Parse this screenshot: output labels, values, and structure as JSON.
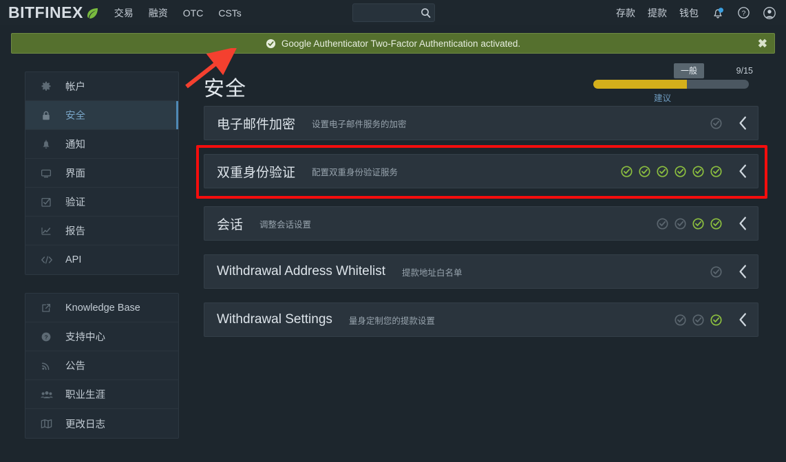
{
  "header": {
    "brand": "BITFINEX",
    "brand_icon": "leaf-icon",
    "nav_left": [
      {
        "label": "交易",
        "name": "nav-trading"
      },
      {
        "label": "融资",
        "name": "nav-funding"
      },
      {
        "label": "OTC",
        "name": "nav-otc"
      },
      {
        "label": "CSTs",
        "name": "nav-csts"
      }
    ],
    "search": {
      "value": "",
      "placeholder": "",
      "icon": "search-icon"
    },
    "nav_right": [
      {
        "label": "存款",
        "name": "nav-deposit"
      },
      {
        "label": "提款",
        "name": "nav-withdraw"
      },
      {
        "label": "钱包",
        "name": "nav-wallet"
      }
    ],
    "icons": [
      {
        "name": "bell-icon",
        "badge_color": "#3a9fe0"
      },
      {
        "name": "help-icon"
      },
      {
        "name": "user-avatar-icon"
      }
    ]
  },
  "alert": {
    "icon": "check-circle-icon",
    "message": "Google Authenticator Two-Factor Authentication activated.",
    "close_label": "✖",
    "bg_color": "#55702e"
  },
  "sidebar": {
    "groups": [
      {
        "items": [
          {
            "label": "帐户",
            "icon": "gear-icon",
            "active": false
          },
          {
            "label": "安全",
            "icon": "lock-icon",
            "active": true
          },
          {
            "label": "通知",
            "icon": "bell-icon",
            "active": false
          },
          {
            "label": "界面",
            "icon": "monitor-icon",
            "active": false
          },
          {
            "label": "验证",
            "icon": "checkbox-icon",
            "active": false
          },
          {
            "label": "报告",
            "icon": "chart-line-icon",
            "active": false
          },
          {
            "label": "API",
            "icon": "code-icon",
            "active": false
          }
        ]
      },
      {
        "items": [
          {
            "label": "Knowledge Base",
            "icon": "external-link-icon",
            "active": false
          },
          {
            "label": "支持中心",
            "icon": "question-circle-icon",
            "active": false
          },
          {
            "label": "公告",
            "icon": "rss-icon",
            "active": false
          },
          {
            "label": "职业生涯",
            "icon": "users-icon",
            "active": false
          },
          {
            "label": "更改日志",
            "icon": "book-icon",
            "active": false
          }
        ]
      }
    ]
  },
  "main": {
    "title": "安全",
    "meter": {
      "bubble_label": "一般",
      "count_label": "9/15",
      "caption": "建议",
      "percent": 60,
      "fill_color": "#d4af1b",
      "track_color": "#4b5761"
    },
    "cards": [
      {
        "title": "电子邮件加密",
        "subtitle": "设置电子邮件服务的加密",
        "checks": [
          "gray"
        ],
        "highlight": false
      },
      {
        "title": "双重身份验证",
        "subtitle": "配置双重身份验证服务",
        "checks": [
          "green",
          "green",
          "green",
          "green",
          "green",
          "green"
        ],
        "highlight": true
      },
      {
        "title": "会话",
        "subtitle": "调整会话设置",
        "checks": [
          "gray",
          "gray",
          "green",
          "green"
        ],
        "highlight": false
      },
      {
        "title": "Withdrawal Address Whitelist",
        "subtitle": "提款地址白名单",
        "checks": [
          "gray"
        ],
        "highlight": false
      },
      {
        "title": "Withdrawal Settings",
        "subtitle": "量身定制您的提款设置",
        "checks": [
          "gray",
          "gray",
          "green"
        ],
        "highlight": false
      }
    ],
    "annotation": {
      "arrow_color": "#f4402f",
      "highlight_color": "#f40d0d"
    }
  }
}
